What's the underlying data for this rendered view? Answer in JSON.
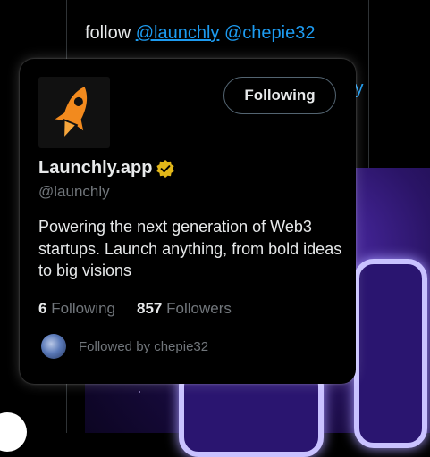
{
  "tweet": {
    "prefix": "follow",
    "mention1": "@launchly",
    "mention2": "@chepie32",
    "partial_mention": "ly"
  },
  "hover_card": {
    "button_label": "Following",
    "name": "Launchly.app",
    "handle": "@launchly",
    "bio": "Powering the next generation of Web3 startups. Launch anything, from bold ideas to big visions",
    "following_count": "6",
    "following_label": "Following",
    "followers_count": "857",
    "followers_label": "Followers",
    "followed_by": "Followed by chepie32"
  },
  "icons": {
    "logo": "rocket-icon",
    "verified": "verified-badge-icon"
  },
  "colors": {
    "link": "#1d9bf0",
    "verified": "#e2b719",
    "rocket": "#f28a1e",
    "muted": "#71767b"
  }
}
